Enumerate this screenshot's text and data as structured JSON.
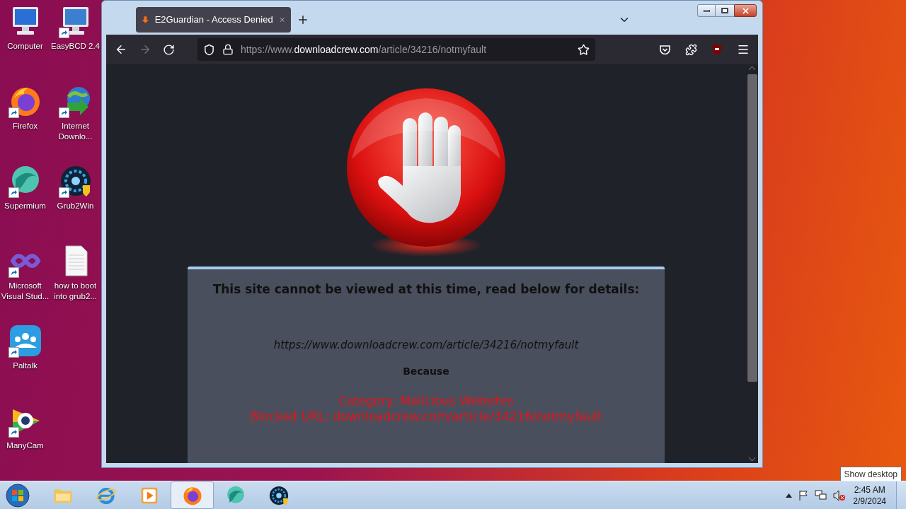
{
  "desktop": {
    "rows": [
      {
        "icons": [
          {
            "label": "Computer",
            "kind": "computer",
            "shortcut": false
          },
          {
            "label": "EasyBCD 2.4",
            "kind": "easybcd",
            "shortcut": true
          }
        ]
      },
      {
        "icons": [
          {
            "label": "Firefox",
            "kind": "firefox",
            "shortcut": true
          },
          {
            "label": "Internet Downlo...",
            "kind": "idm",
            "shortcut": true
          }
        ]
      },
      {
        "icons": [
          {
            "label": "Supermium",
            "kind": "supermium",
            "shortcut": true
          },
          {
            "label": "Grub2Win",
            "kind": "grub",
            "shortcut": true
          }
        ]
      },
      {
        "icons": [
          {
            "label": "Microsoft Visual Stud...",
            "kind": "vs",
            "shortcut": true
          },
          {
            "label": "how to boot into grub2...",
            "kind": "textfile",
            "shortcut": false
          }
        ]
      },
      {
        "icons": [
          {
            "label": "Paltalk",
            "kind": "paltalk",
            "shortcut": true
          }
        ]
      },
      {
        "icons": [
          {
            "label": "ManyCam",
            "kind": "manycam",
            "shortcut": true
          }
        ]
      }
    ]
  },
  "browser": {
    "tabs": [
      {
        "title": "E2Guardian - Access Denied",
        "selected": true
      }
    ],
    "address": {
      "prefix": "https://www.",
      "domain": "downloadcrew.com",
      "path": "/article/34216/notmyfault"
    },
    "forward_disabled": true,
    "page": {
      "heading": "This site cannot be viewed at this time, read below for details:",
      "url": "https://www.downloadcrew.com/article/34216/notmyfault",
      "because": "Because",
      "reasons": [
        "Category: Malicious Websites",
        "Blocked URL: downloadcrew.com/article/34216/notmyfault"
      ]
    }
  },
  "taskbar": {
    "items": [
      {
        "kind": "explorer",
        "selected": false
      },
      {
        "kind": "ie",
        "selected": false
      },
      {
        "kind": "media",
        "selected": false
      },
      {
        "kind": "firefox",
        "selected": true
      },
      {
        "kind": "supermium",
        "selected": false
      },
      {
        "kind": "grub",
        "selected": false
      }
    ],
    "time": "2:45 AM",
    "date": "2/9/2024",
    "tooltip": "Show desktop"
  }
}
